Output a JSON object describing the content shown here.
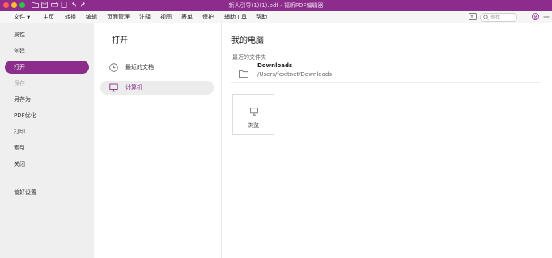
{
  "window": {
    "title": "新人引导(1)(1).pdf - 福昕PDF编辑器"
  },
  "menubar": {
    "file": "文件",
    "items": [
      "主页",
      "转换",
      "编辑",
      "页面管理",
      "注释",
      "视图",
      "表单",
      "保护",
      "辅助工具",
      "帮助"
    ],
    "search_placeholder": "查找"
  },
  "sidebar": {
    "items": [
      "属性",
      "创建",
      "打开",
      "保存",
      "另存为",
      "PDF优化",
      "打印",
      "索引",
      "关闭"
    ],
    "preferences": "偏好设置"
  },
  "open_panel": {
    "heading": "打开",
    "recent_docs": "最近的文档",
    "computer": "计算机"
  },
  "computer_panel": {
    "heading": "我的电脑",
    "recent_folders_label": "最近的文件夹",
    "folder_name": "Downloads",
    "folder_path": "/Users/foxitnet/Downloads",
    "browse_label": "浏览"
  },
  "colors": {
    "accent": "#8c2d8c"
  },
  "icons": [
    "clock-icon",
    "monitor-icon",
    "folder-icon",
    "search-icon",
    "user-icon",
    "menu-icon"
  ]
}
